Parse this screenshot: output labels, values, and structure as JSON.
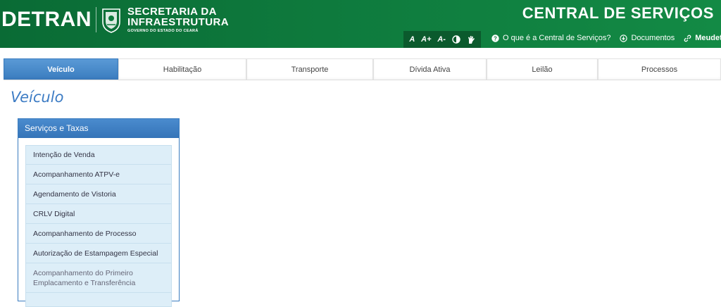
{
  "header": {
    "logo_text": "DETRAN",
    "secretaria_line1": "SECRETARIA DA",
    "secretaria_line2": "INFRAESTRUTURA",
    "secretaria_sub": "GOVERNO DO ESTADO DO CEARÁ",
    "central_title": "CENTRAL DE SERVIÇOS",
    "accessibility": {
      "font_normal": "A",
      "font_increase": "A+",
      "font_decrease": "A-"
    },
    "links": [
      {
        "label": "O que é a Central de Serviços?",
        "icon": "question-circle-icon"
      },
      {
        "label": "Documentos",
        "icon": "download-circle-icon"
      },
      {
        "label": "Meudetran",
        "icon": "link-icon"
      }
    ]
  },
  "tabs": [
    {
      "label": "Veículo",
      "active": true
    },
    {
      "label": "Habilitação",
      "active": false
    },
    {
      "label": "Transporte",
      "active": false
    },
    {
      "label": "Dívida Ativa",
      "active": false
    },
    {
      "label": "Leilão",
      "active": false
    },
    {
      "label": "Processos",
      "active": false
    }
  ],
  "page_title": "Veículo",
  "panel": {
    "title": "Serviços e Taxas",
    "items": [
      "Intenção de Venda",
      "Acompanhamento ATPV-e",
      "Agendamento de Vistoria",
      "CRLV Digital",
      "Acompanhamento de Processo",
      "Autorização de Estampagem Especial",
      "Acompanhamento do Primeiro Emplacamento e Transferência"
    ]
  },
  "colors": {
    "header_green": "#0e7a3d",
    "accent_blue": "#3a7cbf",
    "list_bg": "#ddeef8"
  }
}
